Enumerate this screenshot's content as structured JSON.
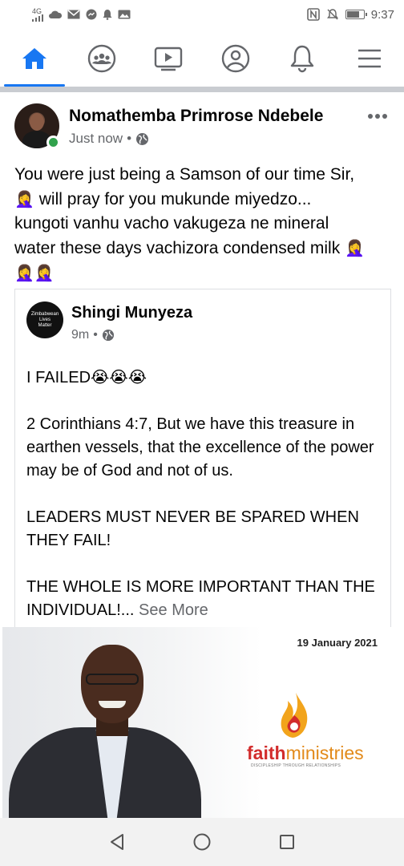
{
  "status_bar": {
    "network_label": "4G",
    "time": "9:37",
    "battery_level": 0.8
  },
  "nav": {
    "items": [
      {
        "name": "home",
        "icon": "home-icon",
        "active": true
      },
      {
        "name": "groups",
        "icon": "groups-icon",
        "active": false
      },
      {
        "name": "watch",
        "icon": "video-icon",
        "active": false
      },
      {
        "name": "profile",
        "icon": "profile-icon",
        "active": false
      },
      {
        "name": "notifications",
        "icon": "bell-icon",
        "active": false
      },
      {
        "name": "menu",
        "icon": "hamburger-menu-icon",
        "active": false
      }
    ],
    "accent_color": "#1877f2"
  },
  "post": {
    "author": "Nomathemba Primrose Ndebele",
    "timestamp": "Just now",
    "separator": "•",
    "text_line1": "You were just being a Samson of our time Sir,",
    "text_line2_emoji": "🤦‍♀️",
    "text_line2": "will pray for you mukunde miyedzo...",
    "text_line3": "kungoti vanhu vacho vakugeza ne mineral",
    "text_line4": "water these days vachizora condensed milk",
    "text_line4_emoji": "🤦‍♀️",
    "text_line5_emoji": "🤦‍♀️🤦‍♀️"
  },
  "shared": {
    "avatar_text_1": "Zimbabwean",
    "avatar_text_2": "Lives",
    "avatar_text_3": "Matter",
    "author": "Shingi Munyeza",
    "timestamp": "9m",
    "separator": "•",
    "para1": "I FAILED",
    "para1_emoji": "😭😭😭",
    "para2": "2 Corinthians 4:7, But we have this treasure in earthen vessels, that the excellence of the power may be of God and not of us.",
    "para3": "LEADERS MUST NEVER BE SPARED WHEN THEY FAIL!",
    "para4": "THE WHOLE IS MORE IMPORTANT THAN THE INDIVIDUAL!...",
    "see_more": "See More"
  },
  "image": {
    "date": "19 January 2021",
    "logo_faith": "faith",
    "logo_ministries": "ministries",
    "logo_tagline": "DISCIPLESHIP THROUGH RELATIONSHIPS"
  }
}
